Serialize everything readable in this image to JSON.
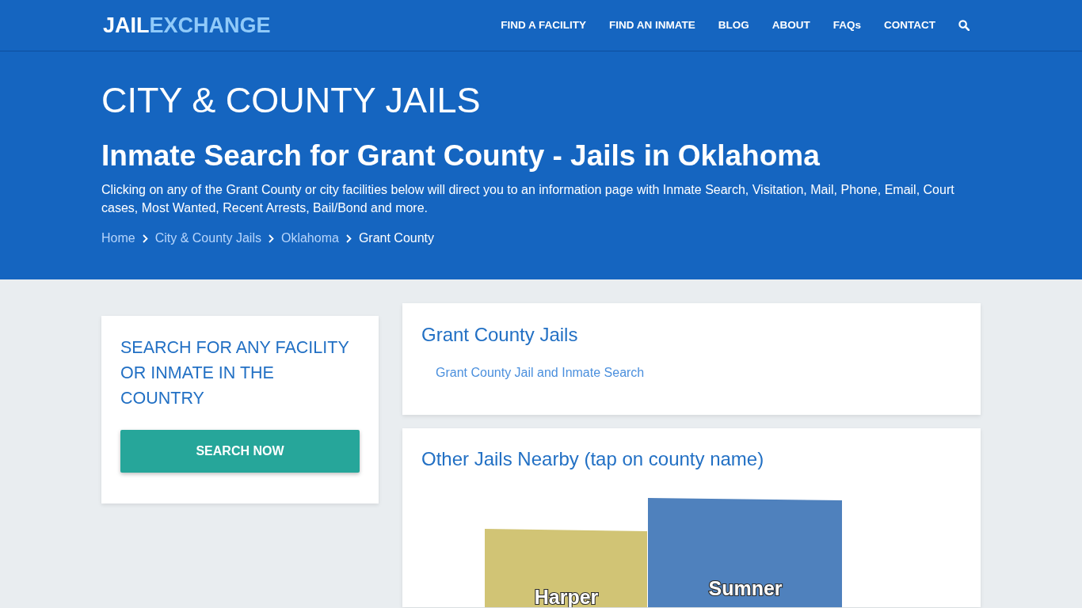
{
  "header": {
    "logo": {
      "primary": "JAIL",
      "secondary": "EXCHANGE"
    },
    "nav": [
      "FIND A FACILITY",
      "FIND AN INMATE",
      "BLOG",
      "ABOUT",
      "FAQs",
      "CONTACT"
    ]
  },
  "hero": {
    "title": "CITY & COUNTY JAILS",
    "subtitle": "Inmate Search for Grant County - Jails in Oklahoma",
    "description": "Clicking on any of the Grant County or city facilities below will direct you to an information page with Inmate Search, Visitation, Mail, Phone, Email, Court cases, Most Wanted, Recent Arrests, Bail/Bond and more.",
    "breadcrumb": {
      "links": [
        "Home",
        "City & County Jails",
        "Oklahoma"
      ],
      "current": "Grant County"
    }
  },
  "search_card": {
    "title": "SEARCH FOR ANY FACILITY OR INMATE IN THE COUNTRY",
    "button": "SEARCH NOW"
  },
  "county_jails": {
    "title": "Grant County Jails",
    "links": [
      "Grant County Jail and Inmate Search"
    ]
  },
  "nearby": {
    "title": "Other Jails Nearby (tap on county name)",
    "counties": [
      {
        "name": "Harper",
        "color": "#d1c475"
      },
      {
        "name": "Sumner",
        "color": "#4f81bd"
      }
    ]
  }
}
